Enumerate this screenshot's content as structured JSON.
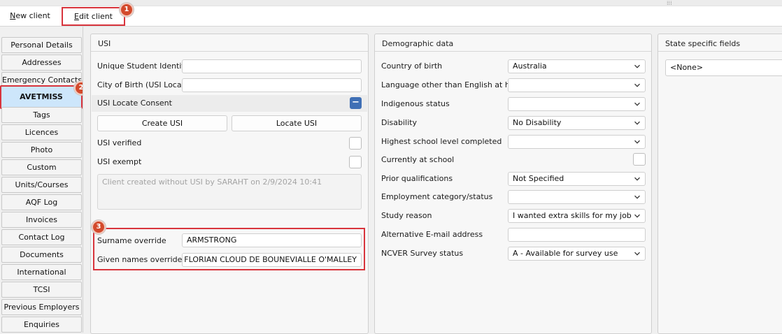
{
  "toolbar": {
    "new_client": {
      "first": "N",
      "rest": "ew client"
    },
    "edit_client": {
      "first": "E",
      "rest": "dit client"
    }
  },
  "badges": {
    "b1": "1",
    "b2": "2",
    "b3": "3"
  },
  "nav": {
    "items": [
      "Personal Details",
      "Addresses",
      "Emergency Contacts",
      "AVETMISS",
      "Tags",
      "Licences",
      "Photo",
      "Custom",
      "Units/Courses",
      "AQF Log",
      "Invoices",
      "Contact Log",
      "Documents",
      "International",
      "TCSI",
      "Previous Employers",
      "Enquiries"
    ],
    "active": "AVETMISS"
  },
  "usi": {
    "title": "USI",
    "unique_student_identifier_label": "Unique Student Identifier",
    "unique_student_identifier_value": "",
    "city_of_birth_label": "City of Birth (USI Locate)",
    "city_of_birth_value": "",
    "locate_consent_label": "USI Locate Consent",
    "locate_consent_symbol": "−",
    "create_usi": "Create USI",
    "locate_usi": "Locate USI",
    "verified_label": "USI verified",
    "exempt_label": "USI exempt",
    "note": "Client created without USI by SARAHT on 2/9/2024 10:41",
    "surname_override_label": "Surname override",
    "surname_override_value": "ARMSTRONG",
    "given_names_override_label": "Given names override",
    "given_names_override_value": "DIDO FLORIAN CLOUD DE BOUNEVIALLE O'MALLEY"
  },
  "demographic": {
    "title": "Demographic data",
    "fields": [
      {
        "label": "Country of birth",
        "value": "Australia",
        "kind": "select"
      },
      {
        "label": "Language other than English at home",
        "value": "",
        "kind": "select"
      },
      {
        "label": "Indigenous status",
        "value": "",
        "kind": "select"
      },
      {
        "label": "Disability",
        "value": "No Disability",
        "kind": "select"
      },
      {
        "label": "Highest school level completed",
        "value": "",
        "kind": "select"
      },
      {
        "label": "Currently at school",
        "value": "",
        "kind": "checkbox"
      },
      {
        "label": "Prior qualifications",
        "value": "Not Specified",
        "kind": "select"
      },
      {
        "label": "Employment category/status",
        "value": "",
        "kind": "select"
      },
      {
        "label": "Study reason",
        "value": "I wanted extra skills for my job",
        "kind": "select"
      },
      {
        "label": "Alternative E-mail address",
        "value": "",
        "kind": "input"
      },
      {
        "label": "NCVER Survey status",
        "value": "A - Available for survey use",
        "kind": "select"
      }
    ]
  },
  "state": {
    "title": "State specific fields",
    "value": "<None>"
  },
  "colors": {
    "highlight_red": "#d8343c",
    "badge": "#d34a2c",
    "active_nav": "#cde6fb",
    "consent_button": "#3f6fb5"
  }
}
